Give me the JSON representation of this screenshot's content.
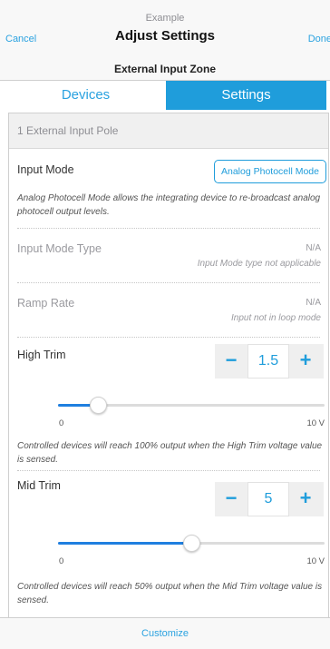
{
  "header": {
    "subtitle": "Example",
    "title": "Adjust Settings",
    "cancel_label": "Cancel",
    "done_label": "Done"
  },
  "zone_title": "External Input Zone",
  "tabs": [
    {
      "label": "Devices",
      "active": false
    },
    {
      "label": "Settings",
      "active": true
    }
  ],
  "pole_title": "1 External Input Pole",
  "input_mode": {
    "label": "Input Mode",
    "value": "Analog Photocell Mode",
    "description": "Analog Photocell Mode allows the integrating device to re-broadcast analog photocell output levels."
  },
  "input_mode_type": {
    "label": "Input Mode Type",
    "value": "N/A",
    "note": "Input Mode type not applicable"
  },
  "ramp_rate": {
    "label": "Ramp Rate",
    "value": "N/A",
    "note": "Input not in loop mode"
  },
  "high_trim": {
    "label": "High Trim",
    "value": "1.5",
    "slider_fraction": 0.15,
    "min_label": "0",
    "max_label": "10 V",
    "minus": "−",
    "plus": "+",
    "description": "Controlled devices will reach 100% output when the High Trim voltage value is sensed."
  },
  "mid_trim": {
    "label": "Mid Trim",
    "value": "5",
    "slider_fraction": 0.5,
    "min_label": "0",
    "max_label": "10 V",
    "minus": "−",
    "plus": "+",
    "description": "Controlled devices will reach 50% output when the Mid Trim voltage value is sensed."
  },
  "footer": {
    "customize_label": "Customize"
  },
  "colors": {
    "accent": "#1f9ddb",
    "slider_fill": "#1f7fe0"
  }
}
